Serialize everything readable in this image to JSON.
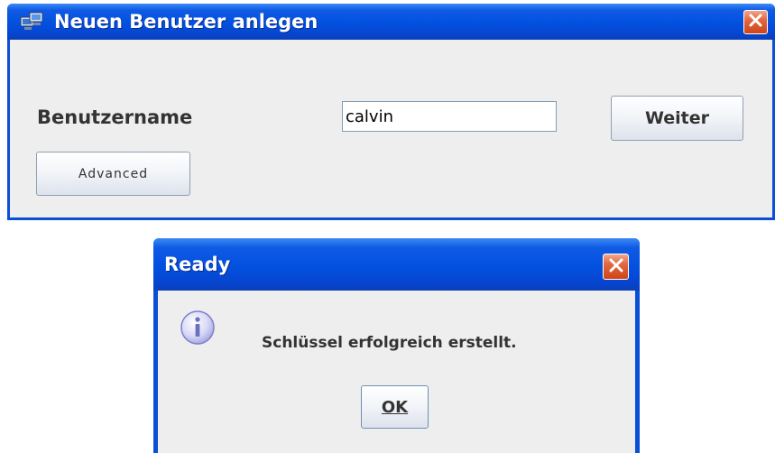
{
  "main_window": {
    "title": "Neuen Benutzer anlegen",
    "app_icon": "network-computers-icon",
    "close_icon": "close-icon",
    "username_label": "Benutzername",
    "username_value": "calvin",
    "next_button": "Weiter",
    "advanced_button": "Advanced"
  },
  "dialog": {
    "title": "Ready",
    "close_icon": "close-icon",
    "info_icon": "info-icon",
    "message": "Schlüssel erfolgreich erstellt.",
    "ok_button": "OK"
  },
  "colors": {
    "titlebar": "#0350e0",
    "window_frame": "#0a4fd6",
    "client_bg": "#eeeeee",
    "close_button": "#e3673f"
  }
}
